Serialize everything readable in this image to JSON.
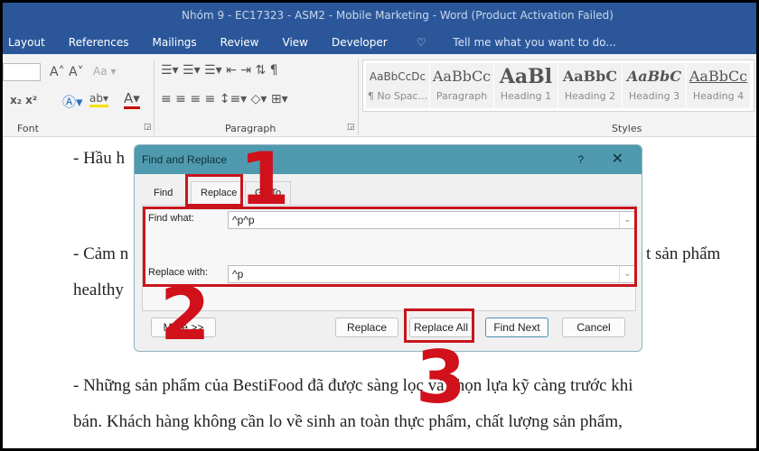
{
  "window": {
    "title": "Nhóm 9 - EC17323 - ASM2 - Mobile Marketing - Word (Product Activation Failed)"
  },
  "ribbon_tabs": [
    "Layout",
    "References",
    "Mailings",
    "Review",
    "View",
    "Developer"
  ],
  "tell_me": "Tell me what you want to do...",
  "groups": {
    "font": "Font",
    "paragraph": "Paragraph",
    "styles": "Styles"
  },
  "styles": [
    {
      "sample": "AaBbCcDc",
      "name": "¶ No Spac..."
    },
    {
      "sample": "AaBbCc",
      "name": "Paragraph"
    },
    {
      "sample": "AaBl",
      "name": "Heading 1"
    },
    {
      "sample": "AaBbC",
      "name": "Heading 2"
    },
    {
      "sample": "AaBbC",
      "name": "Heading 3"
    },
    {
      "sample": "AaBbCc",
      "name": "Heading 4"
    }
  ],
  "document": {
    "lines": [
      "- Hầu h",
      "- Cảm n",
      "t sản phẩm",
      "healthy",
      "- Những sản phẩm của BestiFood đã được sàng lọc và chọn lựa kỹ càng trước khi",
      "bán. Khách hàng không cần lo về sinh an toàn thực phẩm, chất lượng sản phẩm,"
    ]
  },
  "dialog": {
    "title": "Find and Replace",
    "help": "?",
    "close": "✕",
    "tabs": [
      "Find",
      "Replace",
      "Go To"
    ],
    "find_label": "Find what:",
    "find_value": "^p^p",
    "replace_label": "Replace with:",
    "replace_value": "^p",
    "buttons": {
      "more": "More >>",
      "replace": "Replace",
      "replace_all": "Replace All",
      "find_next": "Find Next",
      "cancel": "Cancel"
    }
  },
  "annotations": [
    "1",
    "2",
    "3"
  ],
  "colors": {
    "word_blue": "#2b579a",
    "dialog_title": "#4f9aae",
    "annotation_red": "#c8151d"
  }
}
